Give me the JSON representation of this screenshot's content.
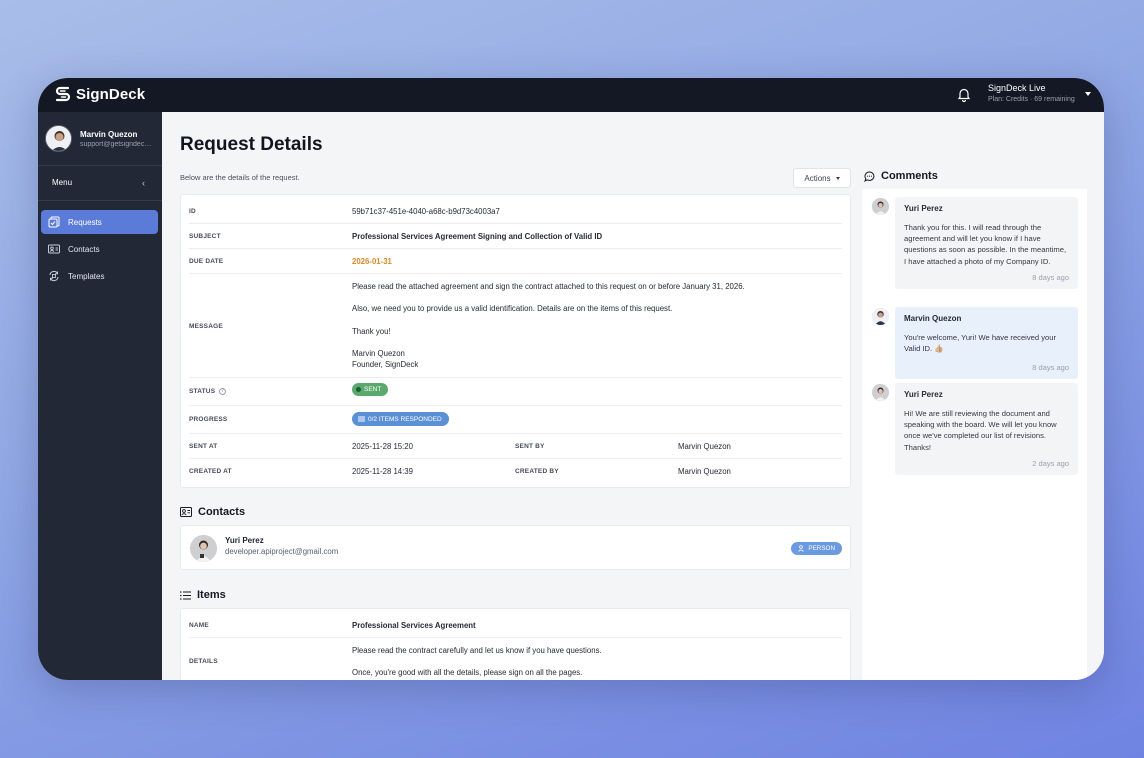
{
  "brand": {
    "name": "SignDeck"
  },
  "account": {
    "name": "SignDeck Live",
    "plan": "Plan: Credits · 69 remaining"
  },
  "user": {
    "name": "Marvin Quezon",
    "email": "support@getsigndeck.com"
  },
  "sidebar": {
    "menu_label": "Menu",
    "items": [
      {
        "label": "Requests",
        "icon": "requests-icon",
        "active": true
      },
      {
        "label": "Contacts",
        "icon": "contacts-icon",
        "active": false
      },
      {
        "label": "Templates",
        "icon": "templates-icon",
        "active": false
      }
    ]
  },
  "page": {
    "title": "Request Details",
    "subtitle": "Below are the details of the request.",
    "actions_label": "Actions"
  },
  "details": {
    "id": {
      "label": "ID",
      "value": "59b71c37-451e-4040-a68c-b9d73c4003a7"
    },
    "subject": {
      "label": "SUBJECT",
      "value": "Professional Services Agreement Signing and Collection of Valid ID"
    },
    "due_date": {
      "label": "DUE DATE",
      "value": "2026-01-31"
    },
    "message": {
      "label": "MESSAGE",
      "lines": [
        "Please read the attached agreement and sign the contract attached to this request on or before January 31, 2026.",
        "Also, we need you to provide us a valid identification. Details are on the items of this request.",
        "Thank you!",
        "Marvin Quezon",
        "Founder, SignDeck"
      ]
    },
    "status": {
      "label": "STATUS",
      "value": "SENT"
    },
    "progress": {
      "label": "PROGRESS",
      "value": "0/2 ITEMS RESPONDED"
    },
    "sent_at": {
      "label": "SENT AT",
      "value": "2025-11-28 15:20"
    },
    "sent_by": {
      "label": "SENT BY",
      "value": "Marvin Quezon"
    },
    "created_at": {
      "label": "CREATED AT",
      "value": "2025-11-28 14:39"
    },
    "created_by": {
      "label": "CREATED BY",
      "value": "Marvin Quezon"
    }
  },
  "contacts": {
    "title": "Contacts",
    "list": [
      {
        "name": "Yuri Perez",
        "email": "developer.apiproject@gmail.com",
        "type": "PERSON"
      }
    ]
  },
  "items": {
    "title": "Items",
    "name_label": "NAME",
    "name_value": "Professional Services Agreement",
    "details_label": "DETAILS",
    "details_lines": [
      "Please read the contract carefully and let us know if you have questions.",
      "Once, you're good with all the details, please sign on all the pages."
    ]
  },
  "comments": {
    "title": "Comments",
    "list": [
      {
        "author": "Yuri Perez",
        "text": "Thank you for this. I will read through the agreement and will let you know if I have questions as soon as possible. In the meantime, I have attached a photo of my Company ID.",
        "time": "8 days ago"
      },
      {
        "author": "Marvin Quezon",
        "text": "You're welcome, Yuri! We have received your Valid ID. 👍🏼",
        "time": "8 days ago"
      },
      {
        "author": "Yuri Perez",
        "text": "Hi! We are still reviewing the document and speaking with the board. We will let you know once we've completed our list of revisions. Thanks!",
        "time": "2 days ago"
      }
    ]
  },
  "colors": {
    "topbar": "#141824",
    "sidebar": "#232836",
    "accent": "#5b7bd9",
    "status_sent": "#5aaa6d",
    "progress_badge": "#5b8fd6",
    "due_date": "#d68a2a"
  }
}
